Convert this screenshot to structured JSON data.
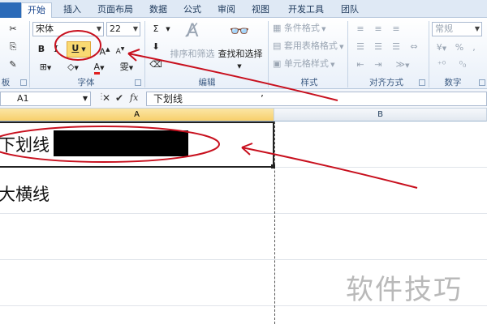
{
  "tabs": [
    {
      "label": "开始",
      "active": true
    },
    {
      "label": "插入"
    },
    {
      "label": "页面布局"
    },
    {
      "label": "数据"
    },
    {
      "label": "公式"
    },
    {
      "label": "审阅"
    },
    {
      "label": "视图"
    },
    {
      "label": "开发工具"
    },
    {
      "label": "团队"
    }
  ],
  "ribbon": {
    "font": {
      "name": "宋体",
      "size": "22",
      "bold": "B",
      "italic": "I",
      "underline": "U",
      "grow": "A",
      "shrink": "A",
      "color_letter": "A",
      "group_label": "字体"
    },
    "clipboard": {
      "group_label": "板"
    },
    "editing": {
      "sigma": "Σ",
      "sort_label": "排序和筛选",
      "find_label": "查找和选择",
      "group_label": "编辑"
    },
    "styles": {
      "conditional": "条件格式",
      "table_format": "套用表格格式",
      "cell_styles": "单元格样式",
      "group_label": "样式"
    },
    "alignment": {
      "group_label": "对齐方式"
    },
    "number": {
      "format": "常规",
      "percent": "%",
      "comma": ",",
      "group_label": "数字"
    }
  },
  "formula_bar": {
    "name_box": "A1",
    "fx": "fx",
    "formula": "下划线",
    "cursor_mark": "’"
  },
  "grid": {
    "columns": [
      {
        "label": "A"
      },
      {
        "label": "B"
      }
    ],
    "cells": {
      "a1": "下划线",
      "a2": "大横线"
    }
  },
  "watermark": "软件技巧",
  "colors": {
    "accent": "#15428b",
    "annotation": "#c8101e",
    "underline_highlight": "#f7d259"
  }
}
